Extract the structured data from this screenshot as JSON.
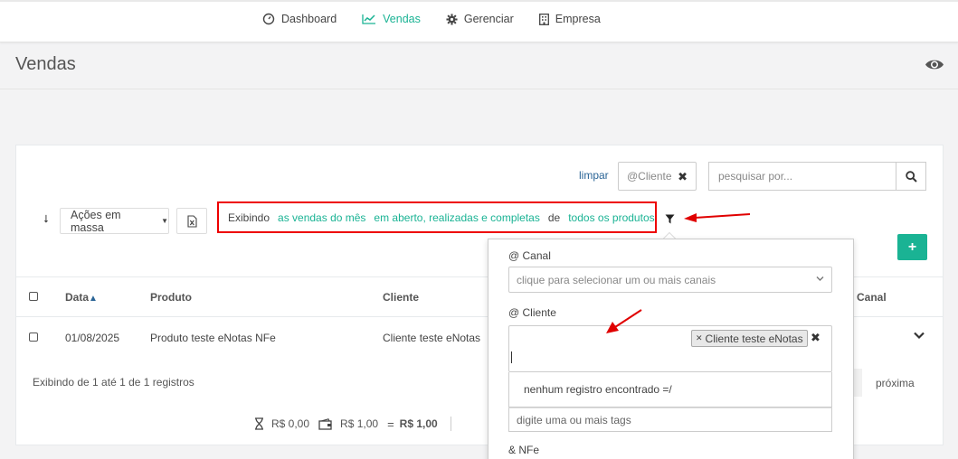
{
  "nav": {
    "items": [
      {
        "label": "Dashboard",
        "icon": "gauge-icon"
      },
      {
        "label": "Vendas",
        "icon": "line-chart-icon",
        "active": true
      },
      {
        "label": "Gerenciar",
        "icon": "gear-icon"
      },
      {
        "label": "Empresa",
        "icon": "building-icon"
      }
    ]
  },
  "header": {
    "title": "Vendas"
  },
  "toolbar": {
    "clear_label": "limpar",
    "active_tag": "@Cliente",
    "search_placeholder": "pesquisar por...",
    "mass_actions_label": "Ações em massa"
  },
  "filter": {
    "prefix": "Exibindo",
    "period": "as vendas do mês",
    "status": "em aberto, realizadas e completas",
    "connector": "de",
    "products": "todos os produtos"
  },
  "table": {
    "columns": [
      "Data",
      "Produto",
      "Cliente",
      "Canal"
    ],
    "sort_indicator": "▲",
    "rows": [
      {
        "data": "01/08/2025",
        "produto": "Produto teste eNotas NFe",
        "cliente": "Cliente teste eNotas"
      }
    ],
    "info": "Exibindo de 1 até 1 de 1 registros",
    "next_label": "próxima"
  },
  "totals": {
    "pending": "R$ 0,00",
    "paid": "R$ 1,00",
    "equals": "=",
    "total": "R$ 1,00"
  },
  "dropdown": {
    "canal_label": "@ Canal",
    "canal_placeholder": "clique para selecionar um ou mais canais",
    "cliente_label": "@ Cliente",
    "cliente_chip": "Cliente teste eNotas",
    "no_results": "nenhum registro encontrado =/",
    "hint": "digite uma ou mais tags",
    "nfe_label": "& NFe"
  },
  "colors": {
    "accent": "#1ab394",
    "annotation": "#e00000",
    "link": "#2a6496"
  }
}
